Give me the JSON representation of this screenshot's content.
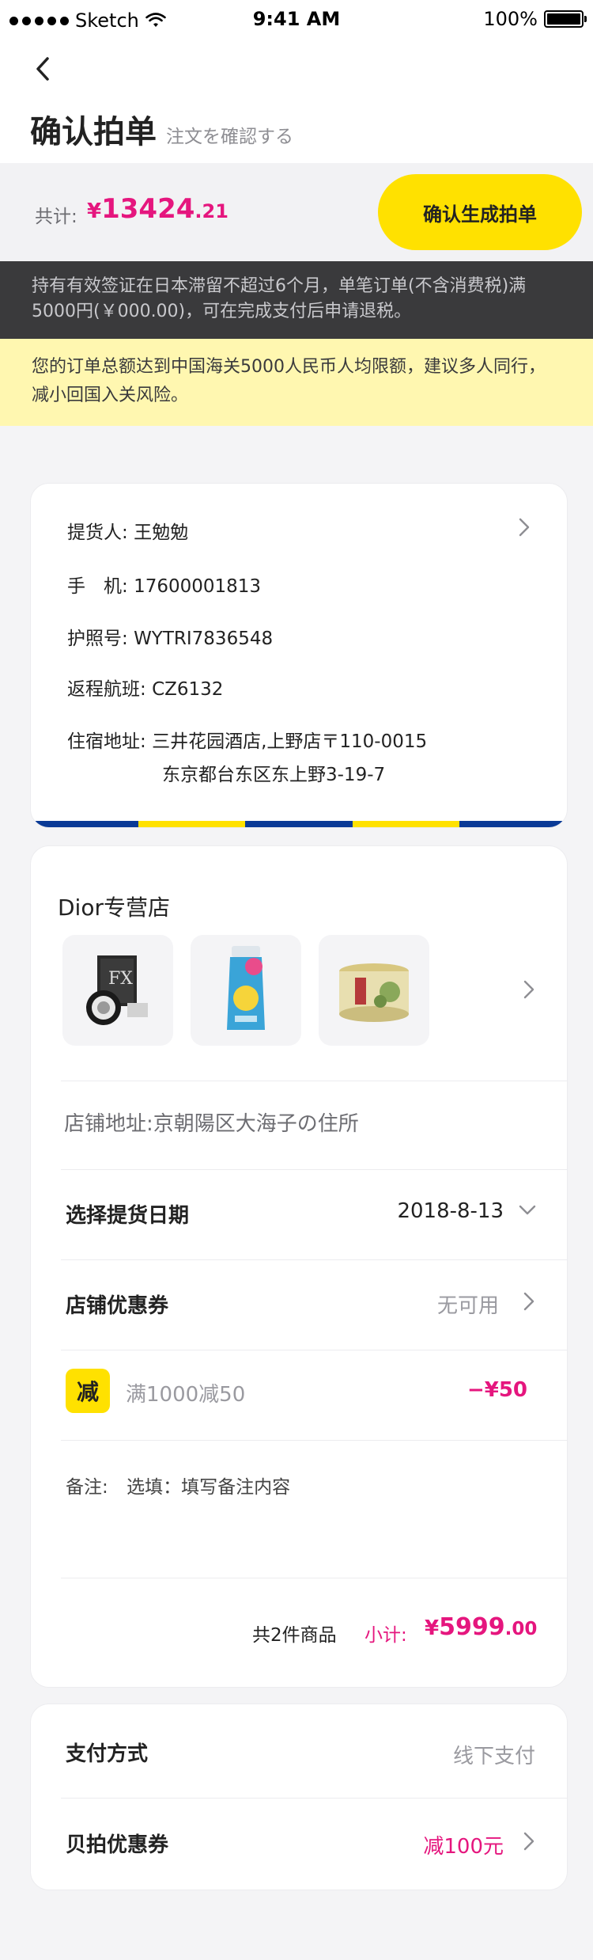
{
  "status_bar": {
    "carrier": "Sketch",
    "time": "9:41 AM",
    "battery": "100%"
  },
  "header": {
    "title": "确认拍单",
    "subtitle": "注文を確認する"
  },
  "summary": {
    "total_label": "共计:",
    "currency": "¥",
    "total_int": "13424",
    "total_dec": ".21",
    "confirm_label": "确认生成拍单"
  },
  "notices": {
    "tax_refund": "持有有效签证在日本滞留不超过6个月，单笔订单(不含消费税)满5000円(￥000.00)，可在完成支付后申请退税。",
    "customs": "您的订单总额达到中国海关5000人民币人均限额，建议多人同行，减小回国入关风险。"
  },
  "pickup": {
    "person_label": "提货人:",
    "person": "王勉勉",
    "phone_label": "手　机:",
    "phone": "17600001813",
    "passport_label": "护照号:",
    "passport": "WYTRI7836548",
    "flight_label": "返程航班:",
    "flight": "CZ6132",
    "address_label": "住宿地址:",
    "address_line1": "三井花园酒店,上野店〒110-0015",
    "address_line2": "东京都台东区东上野3-19-7",
    "stripe_colors": [
      "#0a3a96",
      "#ffe100",
      "#0a3a96",
      "#ffe100",
      "#0a3a96"
    ]
  },
  "store": {
    "name": "Dior专营店",
    "thumbnails": [
      "eyedrop-box-icon",
      "sunscreen-tube-icon",
      "cream-jar-icon"
    ],
    "address_label": "店铺地址:",
    "address": "京朝陽区大海子の住所",
    "date_label": "选择提货日期",
    "date": "2018-8-13",
    "coupon_label": "店铺优惠券",
    "coupon_value": "无可用",
    "discount_badge": "减",
    "discount_text": "满1000减50",
    "discount_amount": "−¥50",
    "note_label": "备注:",
    "note_placeholder": "选填：填写备注内容",
    "item_count": "共2件商品",
    "subtotal_label": "小计:",
    "subtotal_currency": "¥",
    "subtotal_int": "5999",
    "subtotal_dec": ".00"
  },
  "payment": {
    "method_label": "支付方式",
    "method_value": "线下支付",
    "coupon_label": "贝拍优惠券",
    "coupon_value": "减100元"
  },
  "colors": {
    "accent_pink": "#e5167e",
    "accent_yellow": "#ffe100",
    "stripe_blue": "#0a3a96"
  }
}
